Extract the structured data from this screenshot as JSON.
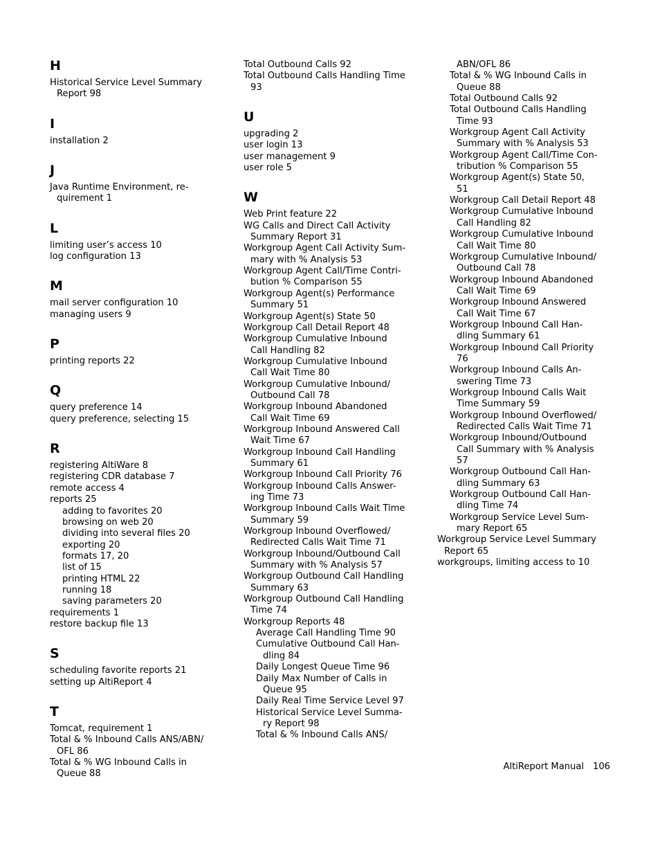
{
  "page": {
    "type": "index",
    "footer_label": "AltiReport Manual",
    "footer_page_number": "106"
  },
  "columns": [
    {
      "id": "column-1",
      "sections": [
        {
          "letter": "H",
          "entries": [
            {
              "kind": "entry",
              "text": "Historical Service Level Summary"
            },
            {
              "kind": "cont",
              "text": "Report 98"
            }
          ]
        },
        {
          "letter": "I",
          "entries": [
            {
              "kind": "entry",
              "text": "installation 2"
            }
          ]
        },
        {
          "letter": "J",
          "entries": [
            {
              "kind": "entry",
              "text": "Java Runtime Environment, re-"
            },
            {
              "kind": "cont",
              "text": "quirement 1"
            }
          ]
        },
        {
          "letter": "L",
          "entries": [
            {
              "kind": "entry",
              "text": "limiting user’s access 10"
            },
            {
              "kind": "entry",
              "text": "log configuration 13"
            }
          ]
        },
        {
          "letter": "M",
          "entries": [
            {
              "kind": "entry",
              "text": "mail server configuration 10"
            },
            {
              "kind": "entry",
              "text": "managing users 9"
            }
          ]
        },
        {
          "letter": "P",
          "entries": [
            {
              "kind": "entry",
              "text": "printing reports 22"
            }
          ]
        },
        {
          "letter": "Q",
          "entries": [
            {
              "kind": "entry",
              "text": "query preference 14"
            },
            {
              "kind": "entry",
              "text": "query preference, selecting 15"
            }
          ]
        },
        {
          "letter": "R",
          "entries": [
            {
              "kind": "entry",
              "text": "registering AltiWare 8"
            },
            {
              "kind": "entry",
              "text": "registering CDR database 7"
            },
            {
              "kind": "entry",
              "text": "remote access 4"
            },
            {
              "kind": "entry",
              "text": "reports 25"
            },
            {
              "kind": "sub",
              "text": "adding to favorites 20"
            },
            {
              "kind": "sub",
              "text": "browsing on web 20"
            },
            {
              "kind": "sub",
              "text": "dividing into several files 20"
            },
            {
              "kind": "sub",
              "text": "exporting 20"
            },
            {
              "kind": "sub",
              "text": "formats 17, 20"
            },
            {
              "kind": "sub",
              "text": "list of 15"
            },
            {
              "kind": "sub",
              "text": "printing HTML 22"
            },
            {
              "kind": "sub",
              "text": "running 18"
            },
            {
              "kind": "sub",
              "text": "saving parameters 20"
            },
            {
              "kind": "entry",
              "text": "requirements 1"
            },
            {
              "kind": "entry",
              "text": "restore backup file 13"
            }
          ]
        },
        {
          "letter": "S",
          "entries": [
            {
              "kind": "entry",
              "text": "scheduling favorite reports 21"
            },
            {
              "kind": "entry",
              "text": "setting up AltiReport 4"
            }
          ]
        },
        {
          "letter": "T",
          "entries": [
            {
              "kind": "entry",
              "text": "Tomcat, requirement 1"
            },
            {
              "kind": "entry",
              "text": "Total & % Inbound Calls ANS/ABN/"
            },
            {
              "kind": "cont",
              "text": "OFL 86"
            },
            {
              "kind": "entry",
              "text": "Total & % WG Inbound Calls in"
            },
            {
              "kind": "cont",
              "text": "Queue 88"
            }
          ]
        }
      ]
    },
    {
      "id": "column-2",
      "sections": [
        {
          "letter": "",
          "entries": [
            {
              "kind": "entry",
              "text": "Total Outbound Calls 92"
            },
            {
              "kind": "entry",
              "text": "Total Outbound Calls Handling Time"
            },
            {
              "kind": "cont",
              "text": "93"
            }
          ]
        },
        {
          "letter": "U",
          "entries": [
            {
              "kind": "entry",
              "text": "upgrading 2"
            },
            {
              "kind": "entry",
              "text": "user login 13"
            },
            {
              "kind": "entry",
              "text": "user management 9"
            },
            {
              "kind": "entry",
              "text": "user role 5"
            }
          ]
        },
        {
          "letter": "W",
          "entries": [
            {
              "kind": "entry",
              "text": "Web Print feature 22"
            },
            {
              "kind": "entry",
              "text": "WG Calls and Direct Call Activity"
            },
            {
              "kind": "cont",
              "text": "Summary Report 31"
            },
            {
              "kind": "entry",
              "text": "Workgroup Agent Call Activity Sum-"
            },
            {
              "kind": "cont",
              "text": "mary with % Analysis 53"
            },
            {
              "kind": "entry",
              "text": "Workgroup Agent Call/Time Contri-"
            },
            {
              "kind": "cont",
              "text": "bution % Comparison 55"
            },
            {
              "kind": "entry",
              "text": "Workgroup Agent(s) Performance"
            },
            {
              "kind": "cont",
              "text": "Summary 51"
            },
            {
              "kind": "entry",
              "text": "Workgroup Agent(s) State 50"
            },
            {
              "kind": "entry",
              "text": "Workgroup Call Detail Report 48"
            },
            {
              "kind": "entry",
              "text": "Workgroup Cumulative Inbound"
            },
            {
              "kind": "cont",
              "text": "Call Handling 82"
            },
            {
              "kind": "entry",
              "text": "Workgroup Cumulative Inbound"
            },
            {
              "kind": "cont",
              "text": "Call Wait Time 80"
            },
            {
              "kind": "entry",
              "text": "Workgroup Cumulative Inbound/"
            },
            {
              "kind": "cont",
              "text": "Outbound Call 78"
            },
            {
              "kind": "entry",
              "text": "Workgroup Inbound Abandoned"
            },
            {
              "kind": "cont",
              "text": "Call Wait Time 69"
            },
            {
              "kind": "entry",
              "text": "Workgroup Inbound Answered Call"
            },
            {
              "kind": "cont",
              "text": "Wait Time 67"
            },
            {
              "kind": "entry",
              "text": "Workgroup Inbound Call Handling"
            },
            {
              "kind": "cont",
              "text": "Summary 61"
            },
            {
              "kind": "entry",
              "text": "Workgroup Inbound Call Priority 76"
            },
            {
              "kind": "entry",
              "text": "Workgroup Inbound Calls Answer-"
            },
            {
              "kind": "cont",
              "text": "ing Time 73"
            },
            {
              "kind": "entry",
              "text": "Workgroup Inbound Calls Wait Time"
            },
            {
              "kind": "cont",
              "text": "Summary 59"
            },
            {
              "kind": "entry",
              "text": "Workgroup Inbound Overflowed/"
            },
            {
              "kind": "cont",
              "text": "Redirected Calls Wait Time 71"
            },
            {
              "kind": "entry",
              "text": "Workgroup Inbound/Outbound Call"
            },
            {
              "kind": "cont",
              "text": "Summary with % Analysis 57"
            },
            {
              "kind": "entry",
              "text": "Workgroup Outbound Call Handling"
            },
            {
              "kind": "cont",
              "text": "Summary 63"
            },
            {
              "kind": "entry",
              "text": "Workgroup Outbound Call Handling"
            },
            {
              "kind": "cont",
              "text": "Time 74"
            },
            {
              "kind": "entry",
              "text": "Workgroup Reports 48"
            },
            {
              "kind": "sub",
              "text": "Average Call Handling Time 90"
            },
            {
              "kind": "sub",
              "text": "Cumulative Outbound Call Han-"
            },
            {
              "kind": "cont-sub",
              "text": "dling 84"
            },
            {
              "kind": "sub",
              "text": "Daily Longest Queue Time 96"
            },
            {
              "kind": "sub",
              "text": "Daily Max Number of Calls in"
            },
            {
              "kind": "cont-sub",
              "text": "Queue 95"
            },
            {
              "kind": "sub",
              "text": "Daily Real Time Service Level 97"
            },
            {
              "kind": "sub",
              "text": "Historical Service Level Summa-"
            },
            {
              "kind": "cont-sub",
              "text": "ry Report 98"
            },
            {
              "kind": "sub",
              "text": "Total & % Inbound Calls ANS/"
            }
          ]
        }
      ]
    },
    {
      "id": "column-3",
      "sections": [
        {
          "letter": "",
          "entries": [
            {
              "kind": "cont-sub",
              "text": "ABN/OFL 86"
            },
            {
              "kind": "sub",
              "text": "Total & % WG Inbound Calls in"
            },
            {
              "kind": "cont-sub",
              "text": "Queue 88"
            },
            {
              "kind": "sub",
              "text": "Total Outbound Calls 92"
            },
            {
              "kind": "sub",
              "text": "Total Outbound Calls Handling"
            },
            {
              "kind": "cont-sub",
              "text": "Time 93"
            },
            {
              "kind": "sub",
              "text": "Workgroup Agent Call Activity"
            },
            {
              "kind": "cont-sub",
              "text": "Summary with % Analysis 53"
            },
            {
              "kind": "sub",
              "text": "Workgroup Agent Call/Time Con-"
            },
            {
              "kind": "cont-sub",
              "text": "tribution % Comparison 55"
            },
            {
              "kind": "sub",
              "text": "Workgroup Agent(s) State 50,"
            },
            {
              "kind": "cont-sub",
              "text": "51"
            },
            {
              "kind": "sub",
              "text": "Workgroup Call Detail Report 48"
            },
            {
              "kind": "sub",
              "text": "Workgroup Cumulative Inbound"
            },
            {
              "kind": "cont-sub",
              "text": "Call Handling 82"
            },
            {
              "kind": "sub",
              "text": "Workgroup Cumulative Inbound"
            },
            {
              "kind": "cont-sub",
              "text": "Call Wait Time 80"
            },
            {
              "kind": "sub",
              "text": "Workgroup Cumulative Inbound/"
            },
            {
              "kind": "cont-sub",
              "text": "Outbound Call 78"
            },
            {
              "kind": "sub",
              "text": "Workgroup Inbound Abandoned"
            },
            {
              "kind": "cont-sub",
              "text": "Call Wait Time 69"
            },
            {
              "kind": "sub",
              "text": "Workgroup Inbound Answered"
            },
            {
              "kind": "cont-sub",
              "text": "Call Wait Time 67"
            },
            {
              "kind": "sub",
              "text": "Workgroup Inbound Call Han-"
            },
            {
              "kind": "cont-sub",
              "text": "dling Summary 61"
            },
            {
              "kind": "sub",
              "text": "Workgroup Inbound Call Priority"
            },
            {
              "kind": "cont-sub",
              "text": "76"
            },
            {
              "kind": "sub",
              "text": "Workgroup Inbound Calls An-"
            },
            {
              "kind": "cont-sub",
              "text": "swering Time 73"
            },
            {
              "kind": "sub",
              "text": "Workgroup Inbound Calls Wait"
            },
            {
              "kind": "cont-sub",
              "text": "Time Summary 59"
            },
            {
              "kind": "sub",
              "text": "Workgroup Inbound Overflowed/"
            },
            {
              "kind": "cont-sub",
              "text": "Redirected Calls Wait Time 71"
            },
            {
              "kind": "sub",
              "text": "Workgroup Inbound/Outbound"
            },
            {
              "kind": "cont-sub",
              "text": "Call Summary with % Analysis"
            },
            {
              "kind": "cont-sub",
              "text": "57"
            },
            {
              "kind": "sub",
              "text": "Workgroup Outbound Call Han-"
            },
            {
              "kind": "cont-sub",
              "text": "dling Summary 63"
            },
            {
              "kind": "sub",
              "text": "Workgroup Outbound Call Han-"
            },
            {
              "kind": "cont-sub",
              "text": "dling Time 74"
            },
            {
              "kind": "sub",
              "text": "Workgroup Service Level Sum-"
            },
            {
              "kind": "cont-sub",
              "text": "mary Report 65"
            },
            {
              "kind": "entry",
              "text": "Workgroup Service Level Summary"
            },
            {
              "kind": "cont",
              "text": "Report 65"
            },
            {
              "kind": "entry",
              "text": "workgroups, limiting access to 10"
            }
          ]
        }
      ]
    }
  ]
}
